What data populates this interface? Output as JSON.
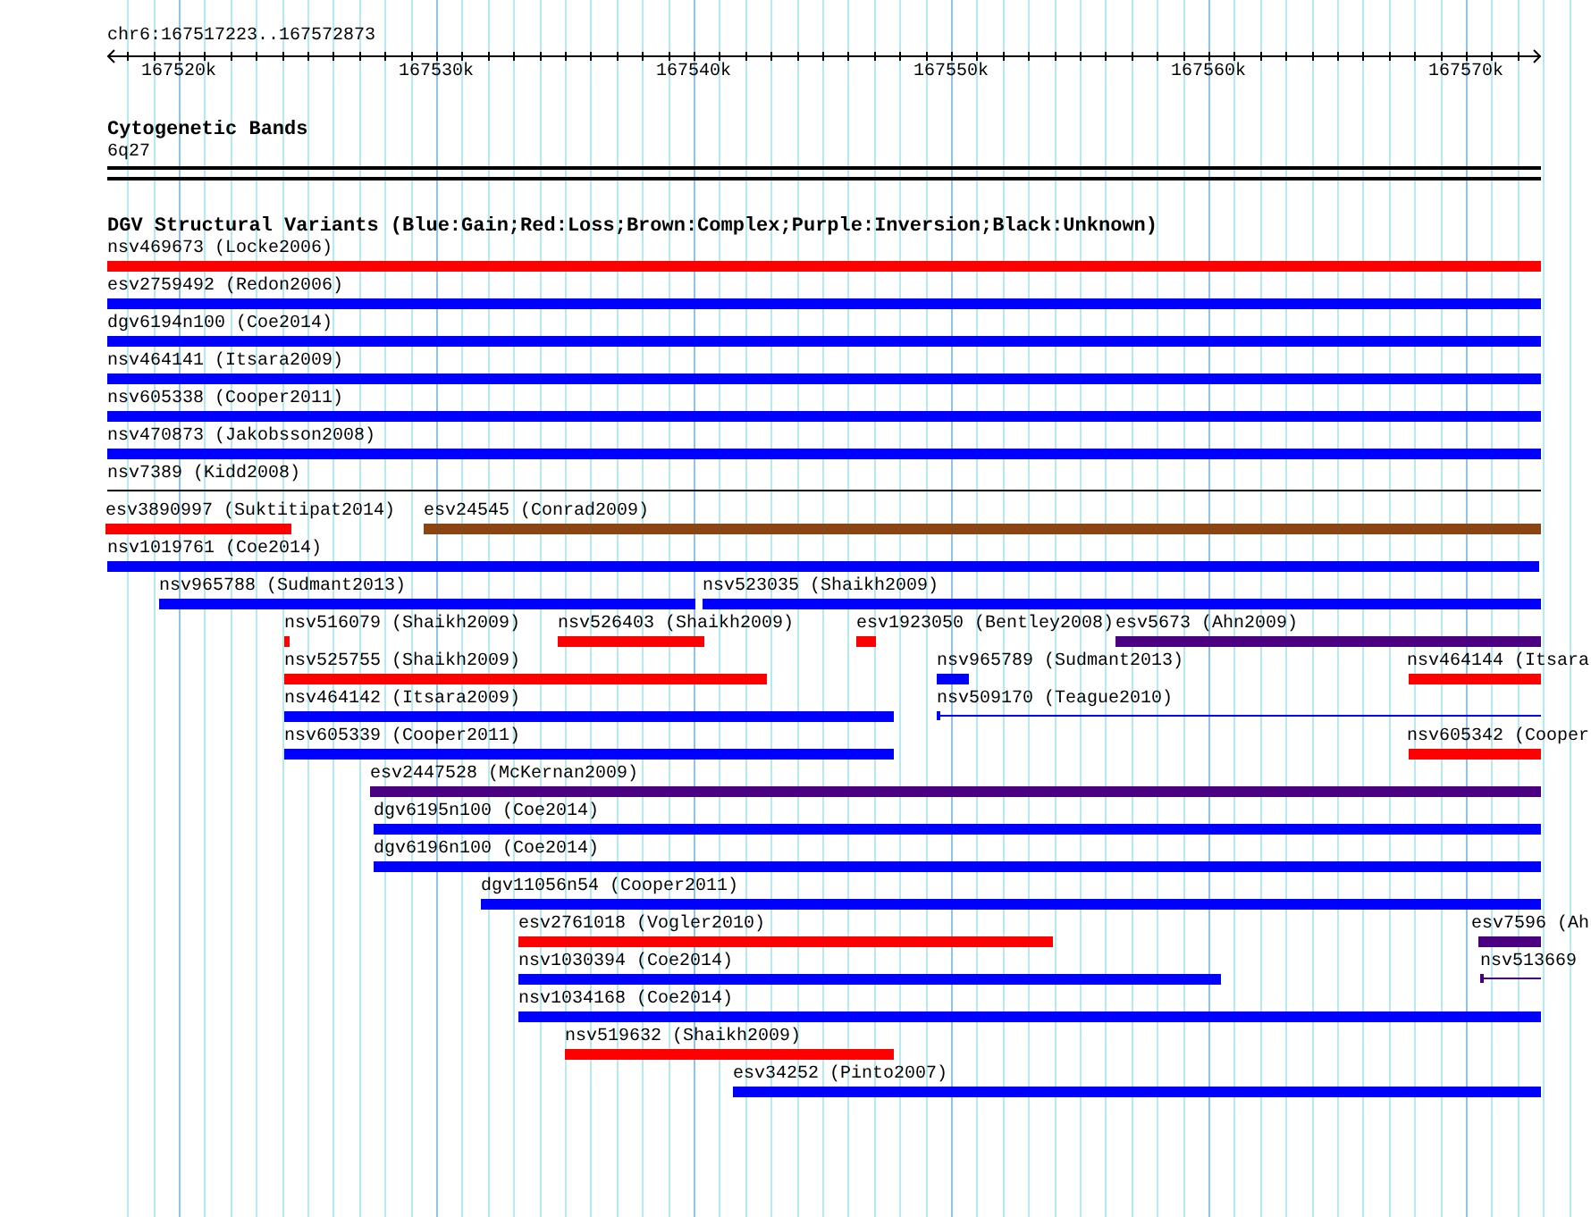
{
  "location": "chr6:167517223..167572873",
  "ruler": {
    "labels": [
      "167520k",
      "167530k",
      "167540k",
      "167550k",
      "167560k",
      "167570k"
    ]
  },
  "cytoband_track": {
    "title": "Cytogenetic Bands",
    "band": "6q27"
  },
  "variant_track": {
    "title": "DGV Structural Variants (Blue:Gain;Red:Loss;Brown:Complex;Purple:Inversion;Black:Unknown)",
    "rows": [
      [
        {
          "label": "nsv469673 (Locke2006)",
          "color": "#ff0000",
          "kind": "bar"
        }
      ],
      [
        {
          "label": "esv2759492 (Redon2006)",
          "color": "#0000ff",
          "kind": "bar"
        }
      ],
      [
        {
          "label": "dgv6194n100 (Coe2014)",
          "color": "#0000ff",
          "kind": "bar"
        }
      ],
      [
        {
          "label": "nsv464141 (Itsara2009)",
          "color": "#0000ff",
          "kind": "bar"
        }
      ],
      [
        {
          "label": "nsv605338 (Cooper2011)",
          "color": "#0000ff",
          "kind": "bar"
        }
      ],
      [
        {
          "label": "nsv470873 (Jakobsson2008)",
          "color": "#0000ff",
          "kind": "bar"
        }
      ],
      [
        {
          "label": "nsv7389 (Kidd2008)",
          "color": "#000000",
          "kind": "line"
        }
      ],
      [
        {
          "label": "esv3890997 (Suktitipat2014)",
          "color": "#ff0000",
          "kind": "bar"
        },
        {
          "label": "esv24545 (Conrad2009)",
          "color": "#8b4513",
          "kind": "bar"
        }
      ],
      [
        {
          "label": "nsv1019761 (Coe2014)",
          "color": "#0000ff",
          "kind": "bar"
        }
      ],
      [
        {
          "label": "nsv965788 (Sudmant2013)",
          "color": "#0000ff",
          "kind": "bar"
        },
        {
          "label": "nsv523035 (Shaikh2009)",
          "color": "#0000ff",
          "kind": "bar"
        }
      ],
      [
        {
          "label": "nsv516079 (Shaikh2009)",
          "color": "#ff0000",
          "kind": "bar"
        },
        {
          "label": "nsv526403 (Shaikh2009)",
          "color": "#ff0000",
          "kind": "bar"
        },
        {
          "label": "esv1923050 (Bentley2008)",
          "color": "#ff0000",
          "kind": "bar"
        },
        {
          "label": "esv5673 (Ahn2009)",
          "color": "#4b0082",
          "kind": "bar"
        }
      ],
      [
        {
          "label": "nsv525755 (Shaikh2009)",
          "color": "#ff0000",
          "kind": "bar"
        },
        {
          "label": "nsv965789 (Sudmant2013)",
          "color": "#0000ff",
          "kind": "bar"
        },
        {
          "label": "nsv464144 (Itsara",
          "color": "#ff0000",
          "kind": "bar"
        }
      ],
      [
        {
          "label": "nsv464142 (Itsara2009)",
          "color": "#0000ff",
          "kind": "bar"
        },
        {
          "label": "nsv509170 (Teague2010)",
          "color": "#0000ff",
          "kind": "line"
        }
      ],
      [
        {
          "label": "nsv605339 (Cooper2011)",
          "color": "#0000ff",
          "kind": "bar"
        },
        {
          "label": "nsv605342 (Cooper",
          "color": "#ff0000",
          "kind": "bar"
        }
      ],
      [
        {
          "label": "esv2447528 (McKernan2009)",
          "color": "#4b0082",
          "kind": "bar"
        }
      ],
      [
        {
          "label": "dgv6195n100 (Coe2014)",
          "color": "#0000ff",
          "kind": "bar"
        }
      ],
      [
        {
          "label": "dgv6196n100 (Coe2014)",
          "color": "#0000ff",
          "kind": "bar"
        }
      ],
      [
        {
          "label": "dgv11056n54 (Cooper2011)",
          "color": "#0000ff",
          "kind": "bar"
        }
      ],
      [
        {
          "label": "esv2761018 (Vogler2010)",
          "color": "#ff0000",
          "kind": "bar"
        },
        {
          "label": "esv7596 (Ah",
          "color": "#4b0082",
          "kind": "bar"
        }
      ],
      [
        {
          "label": "nsv1030394 (Coe2014)",
          "color": "#0000ff",
          "kind": "bar"
        },
        {
          "label": "nsv513669",
          "color": "#4b0082",
          "kind": "line"
        }
      ],
      [
        {
          "label": "nsv1034168 (Coe2014)",
          "color": "#0000ff",
          "kind": "bar"
        }
      ],
      [
        {
          "label": "nsv519632 (Shaikh2009)",
          "color": "#ff0000",
          "kind": "bar"
        }
      ],
      [
        {
          "label": "esv34252 (Pinto2007)",
          "color": "#0000ff",
          "kind": "bar"
        }
      ]
    ]
  }
}
